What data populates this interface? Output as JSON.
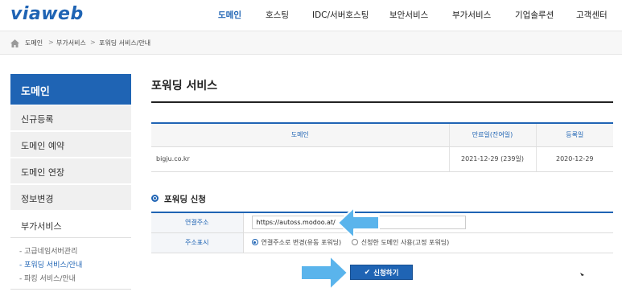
{
  "brand": {
    "logo": "viaweb",
    "accent": "#1f64b4"
  },
  "gnb": [
    {
      "label": "도메인",
      "active": true
    },
    {
      "label": "호스팅"
    },
    {
      "label": "IDC/서버호스팅"
    },
    {
      "label": "보안서비스"
    },
    {
      "label": "부가서비스"
    },
    {
      "label": "기업솔루션"
    },
    {
      "label": "고객센터"
    }
  ],
  "breadcrumb": {
    "icon": "home-icon",
    "items": [
      "도메인",
      "부가서비스",
      "포워딩 서비스/안내"
    ],
    "separator": ">"
  },
  "sidebar": {
    "title": "도메인",
    "items": [
      "신규등록",
      "도메인 예약",
      "도메인 연장",
      "정보변경",
      "부가서비스"
    ],
    "subitems": [
      "- 고급네임서버관리",
      "- 포워딩 서비스/안내",
      "- 파킹 서비스/안내"
    ],
    "active_sub": 1
  },
  "main": {
    "title": "포워딩 서비스",
    "table": {
      "headers": [
        "도메인",
        "만료일(잔여일)",
        "등록일"
      ],
      "rows": [
        [
          "bigju.co.kr",
          "2021-12-29 (239일)",
          "2020-12-29"
        ]
      ]
    },
    "section_title": "포워딩 신청",
    "form": {
      "url_label": "연결주소",
      "url_value": "https://autoss.modoo.at/",
      "display_label": "주소표시",
      "option1": "연결주소로 변경(유동 포워딩)",
      "option2": "신청한 도메인 사용(고정 포워딩)",
      "selected_option": 1
    },
    "submit_label": "신청하기"
  },
  "annotation_color": "#5ab4ec"
}
